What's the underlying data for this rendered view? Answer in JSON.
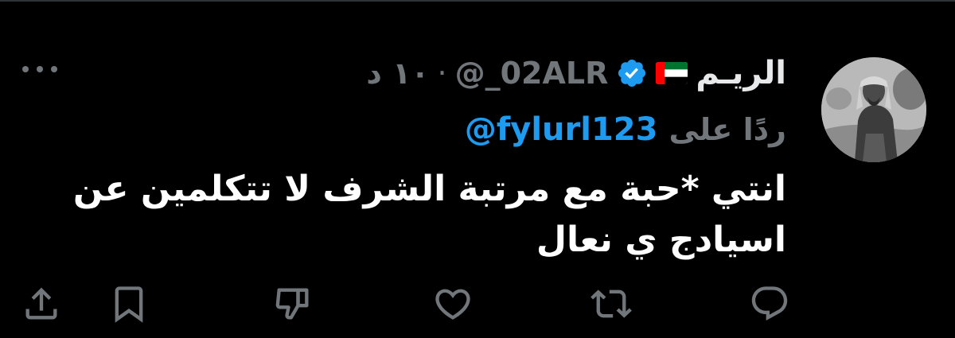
{
  "tweet": {
    "author": {
      "display_name": "الريـم",
      "flag_icon": "uae-flag-icon",
      "verified_icon": "verified-badge-icon",
      "handle": "@_02ALR",
      "time_separator": "·",
      "time": "١٠ د"
    },
    "reply": {
      "prefix": "ردًا على",
      "mention": "@fylurl123"
    },
    "body_lines": [
      "انتي *حبة مع مرتبة الشرف لا تتكلمين عن",
      "اسيادج ي نعال"
    ],
    "actions": [
      {
        "name": "reply-icon"
      },
      {
        "name": "retweet-icon"
      },
      {
        "name": "like-icon"
      },
      {
        "name": "dislike-icon"
      },
      {
        "name": "bookmark-icon"
      },
      {
        "name": "share-icon"
      }
    ],
    "more_icon": "more-options-icon"
  },
  "colors": {
    "background": "#000000",
    "text_primary": "#e7e9ea",
    "text_secondary": "#71767b",
    "accent": "#1d9bf0"
  }
}
